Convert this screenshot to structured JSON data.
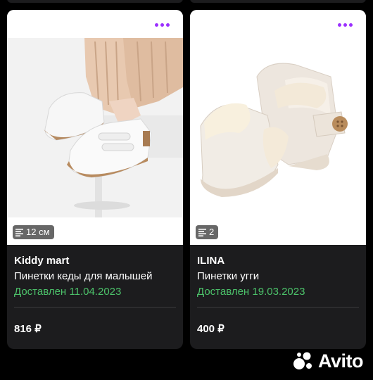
{
  "listings": [
    {
      "seller": "Kiddy mart",
      "title": "Пинетки кеды для малышей",
      "status": "Доставлен 11.04.2023",
      "price": "816 ₽",
      "badge": "12 см",
      "photo": "white-baby-sneakers-photo"
    },
    {
      "seller": "ILINA",
      "title": "Пинетки угги",
      "status": "Доставлен 19.03.2023",
      "price": "400 ₽",
      "badge": "2",
      "photo": "white-baby-ugg-boots-photo"
    }
  ],
  "colors": {
    "card_bg": "#1c1c1e",
    "accent_dots": "#9b30ff",
    "status_green": "#4cc26a",
    "page_bg": "#000000"
  },
  "watermark": {
    "text": "Avito"
  }
}
